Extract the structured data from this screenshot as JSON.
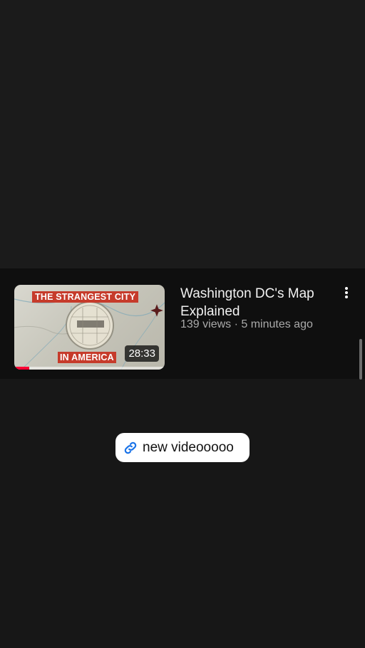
{
  "video": {
    "thumbnail_text_top": "THE STRANGEST CITY",
    "thumbnail_text_bottom": "IN AMERICA",
    "duration": "28:33",
    "watch_progress": 0.1,
    "title": "Washington DC's Map Explained",
    "meta": "139 views · 5 minutes ago",
    "menu_icon": "more-vert-icon"
  },
  "link_chip": {
    "icon": "link-icon",
    "label": "new videooooo",
    "accent_color": "#1a73e8"
  },
  "colors": {
    "background": "#171717",
    "card": "#0f0f0f",
    "thumbnail_banner": "#c63b2b",
    "progress": "#ff0033"
  }
}
